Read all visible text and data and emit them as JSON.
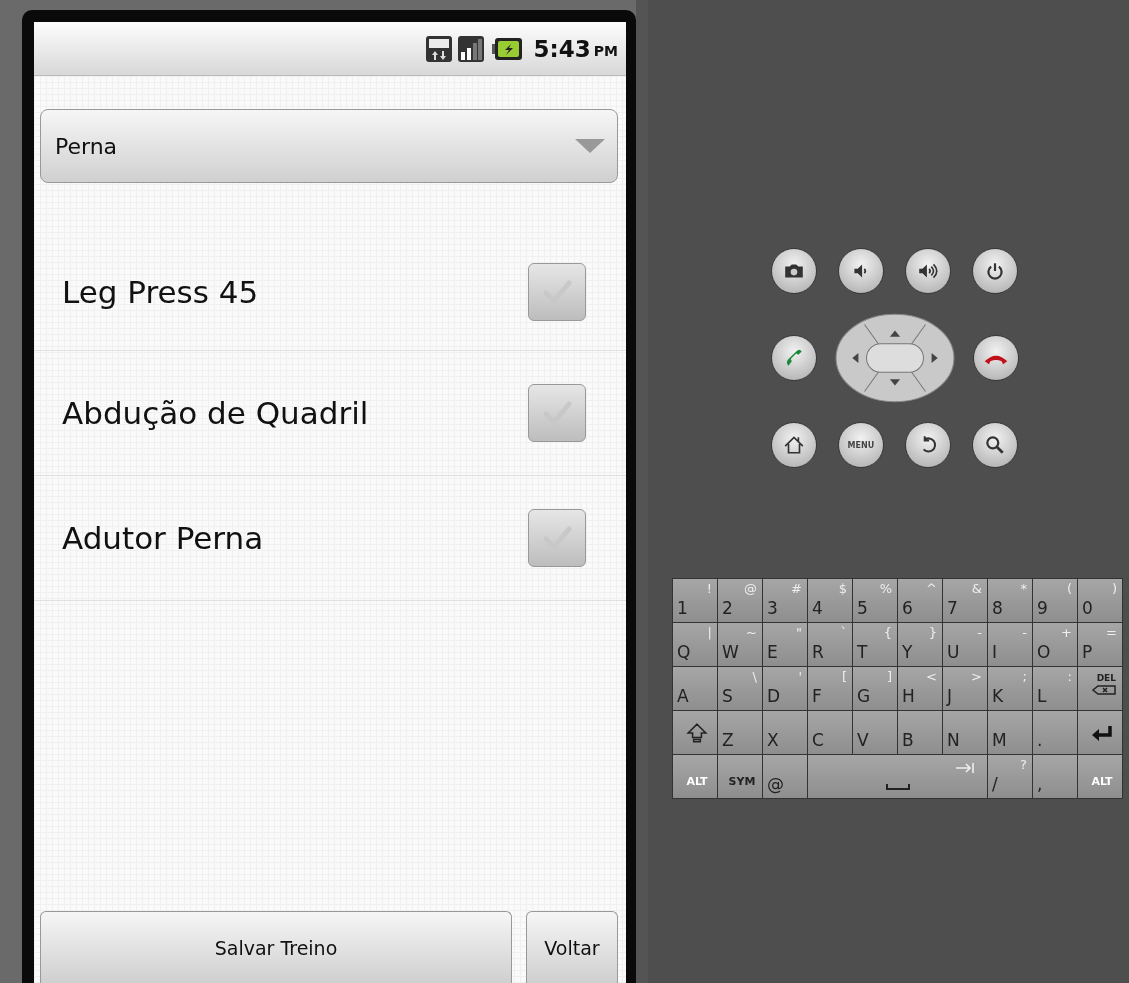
{
  "status_bar": {
    "time": "5:43",
    "ampm": "PM"
  },
  "spinner": {
    "value": "Perna"
  },
  "exercises": [
    {
      "name": "Leg Press 45",
      "checked": false
    },
    {
      "name": "Abdução de Quadril",
      "checked": false
    },
    {
      "name": "Adutor Perna",
      "checked": false
    }
  ],
  "buttons": [
    {
      "label": "Salvar Treino",
      "kind": "wide"
    },
    {
      "label": "Voltar",
      "kind": "narrow"
    }
  ],
  "hardware_buttons": [
    [
      {
        "kind": "camera"
      },
      {
        "kind": "volume-down"
      },
      {
        "kind": "volume-up"
      },
      {
        "kind": "power"
      }
    ],
    [
      {
        "kind": "call"
      },
      {
        "kind": "dpad"
      },
      {
        "kind": "end-call"
      }
    ],
    [
      {
        "kind": "home"
      },
      {
        "kind": "menu",
        "label": "MENU"
      },
      {
        "kind": "back"
      },
      {
        "kind": "search"
      }
    ]
  ],
  "keyboard": [
    [
      {
        "kind": "char",
        "label": "1",
        "alt": "!"
      },
      {
        "kind": "char",
        "label": "2",
        "alt": "@"
      },
      {
        "kind": "char",
        "label": "3",
        "alt": "#"
      },
      {
        "kind": "char",
        "label": "4",
        "alt": "$"
      },
      {
        "kind": "char",
        "label": "5",
        "alt": "%"
      },
      {
        "kind": "char",
        "label": "6",
        "alt": "^"
      },
      {
        "kind": "char",
        "label": "7",
        "alt": "&"
      },
      {
        "kind": "char",
        "label": "8",
        "alt": "*"
      },
      {
        "kind": "char",
        "label": "9",
        "alt": "("
      },
      {
        "kind": "char",
        "label": "0",
        "alt": ")"
      }
    ],
    [
      {
        "kind": "char",
        "label": "Q",
        "alt": "|"
      },
      {
        "kind": "char",
        "label": "W",
        "alt": "~"
      },
      {
        "kind": "char",
        "label": "E",
        "alt": "\""
      },
      {
        "kind": "char",
        "label": "R",
        "alt": "`"
      },
      {
        "kind": "char",
        "label": "T",
        "alt": "{"
      },
      {
        "kind": "char",
        "label": "Y",
        "alt": "}"
      },
      {
        "kind": "char",
        "label": "U",
        "alt": "-"
      },
      {
        "kind": "char",
        "label": "I",
        "alt": "-"
      },
      {
        "kind": "char",
        "label": "O",
        "alt": "+"
      },
      {
        "kind": "char",
        "label": "P",
        "alt": "="
      }
    ],
    [
      {
        "kind": "char",
        "label": "A"
      },
      {
        "kind": "char",
        "label": "S",
        "alt": "\\"
      },
      {
        "kind": "char",
        "label": "D",
        "alt": "'"
      },
      {
        "kind": "char",
        "label": "F",
        "alt": "["
      },
      {
        "kind": "char",
        "label": "G",
        "alt": "]"
      },
      {
        "kind": "char",
        "label": "H",
        "alt": "<"
      },
      {
        "kind": "char",
        "label": "J",
        "alt": ">"
      },
      {
        "kind": "char",
        "label": "K",
        "alt": ";"
      },
      {
        "kind": "char",
        "label": "L",
        "alt": ":"
      },
      {
        "kind": "delete",
        "label": "DEL"
      }
    ],
    [
      {
        "kind": "shift"
      },
      {
        "kind": "char",
        "label": "Z"
      },
      {
        "kind": "char",
        "label": "X"
      },
      {
        "kind": "char",
        "label": "C"
      },
      {
        "kind": "char",
        "label": "V"
      },
      {
        "kind": "char",
        "label": "B"
      },
      {
        "kind": "char",
        "label": "N"
      },
      {
        "kind": "char",
        "label": "M"
      },
      {
        "kind": "char",
        "label": "."
      },
      {
        "kind": "enter"
      }
    ],
    [
      {
        "kind": "mod",
        "label": "ALT"
      },
      {
        "kind": "mod",
        "label": "SYM"
      },
      {
        "kind": "char",
        "label": "@"
      },
      {
        "kind": "space"
      },
      {
        "kind": "char",
        "label": "/",
        "alt": "?"
      },
      {
        "kind": "char",
        "label": ","
      },
      {
        "kind": "mod",
        "label": "ALT"
      }
    ]
  ]
}
